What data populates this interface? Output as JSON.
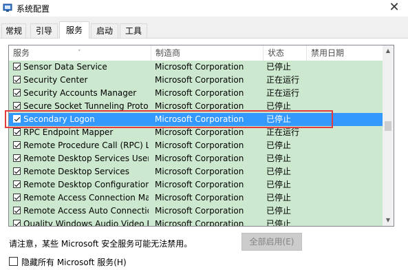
{
  "window": {
    "title": "系统配置",
    "app_icon": "msconfig-icon",
    "close_symbol": "✕"
  },
  "tabs": [
    {
      "label": "常规",
      "active": false
    },
    {
      "label": "引导",
      "active": false
    },
    {
      "label": "服务",
      "active": true
    },
    {
      "label": "启动",
      "active": false
    },
    {
      "label": "工具",
      "active": false
    }
  ],
  "columns": {
    "service": "服务",
    "manufacturer": "制造商",
    "status": "状态",
    "disabled_date": "禁用日期",
    "sort_indicator": "˅"
  },
  "services": [
    {
      "name": "Sensor Data Service",
      "manufacturer": "Microsoft Corporation",
      "status": "已停止",
      "checked": true
    },
    {
      "name": "Security Center",
      "manufacturer": "Microsoft Corporation",
      "status": "正在运行",
      "checked": true
    },
    {
      "name": "Security Accounts Manager",
      "manufacturer": "Microsoft Corporation",
      "status": "正在运行",
      "checked": true
    },
    {
      "name": "Secure Socket Tunneling Protoco...",
      "manufacturer": "Microsoft Corporation",
      "status": "已停止",
      "checked": true
    },
    {
      "name": "Secondary Logon",
      "manufacturer": "Microsoft Corporation",
      "status": "已停止",
      "checked": true,
      "selected": true
    },
    {
      "name": "RPC Endpoint Mapper",
      "manufacturer": "Microsoft Corporation",
      "status": "正在运行",
      "checked": true
    },
    {
      "name": "Remote Procedure Call (RPC) Loc...",
      "manufacturer": "Microsoft Corporation",
      "status": "已停止",
      "checked": true
    },
    {
      "name": "Remote Desktop Services UserM...",
      "manufacturer": "Microsoft Corporation",
      "status": "已停止",
      "checked": true
    },
    {
      "name": "Remote Desktop Services",
      "manufacturer": "Microsoft Corporation",
      "status": "已停止",
      "checked": true
    },
    {
      "name": "Remote Desktop Configuration",
      "manufacturer": "Microsoft Corporation",
      "status": "已停止",
      "checked": true
    },
    {
      "name": "Remote Access Connection Man...",
      "manufacturer": "Microsoft Corporation",
      "status": "已停止",
      "checked": true
    },
    {
      "name": "Remote Access Auto Connection ...",
      "manufacturer": "Microsoft Corporation",
      "status": "已停止",
      "checked": true
    },
    {
      "name": "Quality Windows Audio Video Ex...",
      "manufacturer": "Microsoft Corporation",
      "status": "已停止",
      "checked": true
    }
  ],
  "scrollbar": {
    "up_symbol": "▲",
    "down_symbol": "▼"
  },
  "footer": {
    "note": "请注意，某些 Microsoft 安全服务可能无法禁用。",
    "enable_all_label": "全部启用(E)",
    "hide_ms_label": "隐藏所有 Microsoft 服务(H)",
    "hide_ms_checked": false
  },
  "colors": {
    "row_bg": "#cce8cf",
    "selected_bg": "#3399ff",
    "highlight_border": "#e5393b"
  }
}
